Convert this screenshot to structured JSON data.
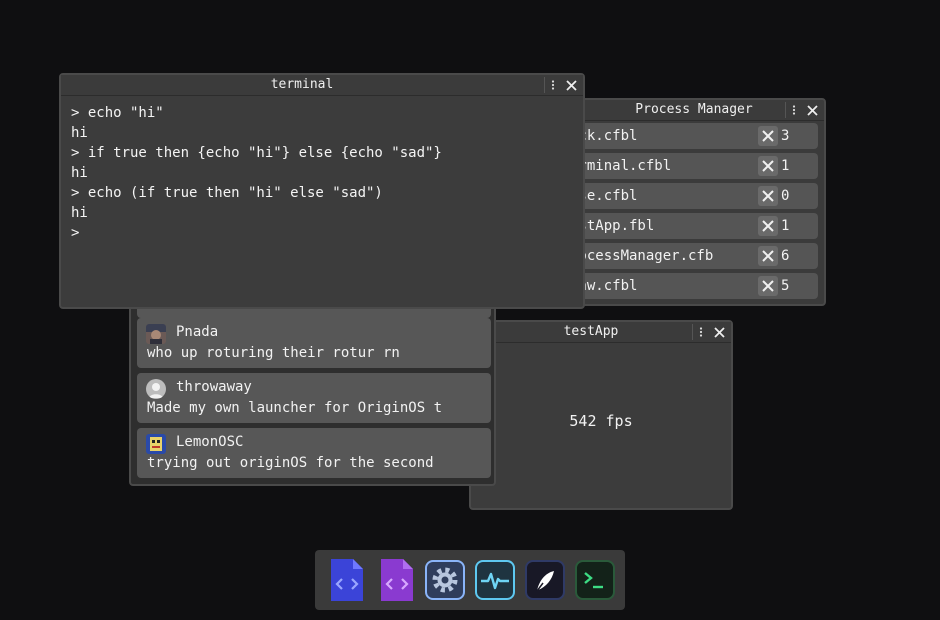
{
  "process_manager": {
    "title": "Process Manager",
    "rows": [
      {
        "name": "ock.cfbl",
        "count": "3"
      },
      {
        "name": "erminal.cfbl",
        "count": "1"
      },
      {
        "name": "ase.cfbl",
        "count": "0"
      },
      {
        "name": "estApp.fbl",
        "count": "1"
      },
      {
        "name": "rocessManager.cfb",
        "count": "6"
      },
      {
        "name": "law.cfbl",
        "count": "5"
      }
    ]
  },
  "test_app": {
    "title": "testApp",
    "fps": "542 fps"
  },
  "feed": {
    "posts": [
      {
        "user": "Pnada",
        "text": "who up roturing their rotur rn",
        "avatar": "photo-avatar"
      },
      {
        "user": "throwaway",
        "text": "Made my own launcher for OriginOS t",
        "avatar": "default-avatar"
      },
      {
        "user": "LemonOSC",
        "text": "trying out originOS for the second",
        "avatar": "pixel-avatar"
      }
    ]
  },
  "terminal": {
    "title": "terminal",
    "lines": [
      "> echo \"hi\"",
      "hi",
      "> if true then {echo \"hi\"} else {echo \"sad\"}",
      "hi",
      "> echo (if true then \"hi\" else \"sad\")",
      "hi",
      ">"
    ]
  },
  "dock": {
    "apps": [
      {
        "icon": "code-file-blue-icon",
        "color": "#3b4fd6"
      },
      {
        "icon": "code-file-purple-icon",
        "color": "#8f3fd1"
      },
      {
        "icon": "settings-gear-icon",
        "color": "#8ab4f8"
      },
      {
        "icon": "activity-monitor-icon",
        "color": "#5ec8f0"
      },
      {
        "icon": "quill-app-icon",
        "color": "#1c1c2e"
      },
      {
        "icon": "terminal-app-icon",
        "color": "#1e3a2a"
      }
    ]
  }
}
